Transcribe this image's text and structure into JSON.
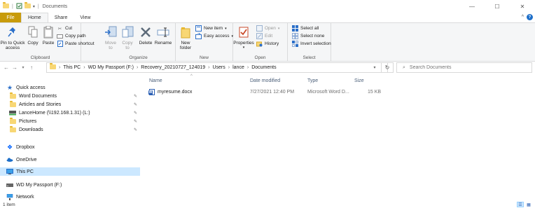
{
  "window": {
    "title": "Documents",
    "minimize": "—",
    "maximize": "☐",
    "close": "✕"
  },
  "ribbon_tabs": [
    "File",
    "Home",
    "Share",
    "View"
  ],
  "ribbon": {
    "clipboard": {
      "label": "Clipboard",
      "pin_to_quick_access": "Pin to Quick access",
      "copy": "Copy",
      "paste": "Paste",
      "cut": "Cut",
      "copy_path": "Copy path",
      "paste_shortcut": "Paste shortcut"
    },
    "organize": {
      "label": "Organize",
      "move_to": "Move to",
      "copy_to": "Copy to",
      "delete": "Delete",
      "rename": "Rename"
    },
    "new": {
      "label": "New",
      "new_folder": "New folder",
      "new_item": "New item",
      "easy_access": "Easy access"
    },
    "open": {
      "label": "Open",
      "properties": "Properties",
      "open": "Open",
      "edit": "Edit",
      "history": "History"
    },
    "select": {
      "label": "Select",
      "select_all": "Select all",
      "select_none": "Select none",
      "invert_selection": "Invert selection"
    }
  },
  "address": {
    "breadcrumbs": [
      "This PC",
      "WD My Passport (F:)",
      "Recovery_20210727_124019",
      "Users",
      "lance",
      "Documents"
    ],
    "search_placeholder": "Search Documents"
  },
  "nav": {
    "quick_access": "Quick access",
    "pinned": [
      "Word Documents",
      "Articles and Stories",
      "LanceHome (\\\\192.168.1.31) (L:)",
      "Pictures",
      "Downloads"
    ],
    "dropbox": "Dropbox",
    "onedrive": "OneDrive",
    "this_pc": "This PC",
    "wd_passport": "WD My Passport (F:)",
    "network": "Network"
  },
  "columns": {
    "name": "Name",
    "date_modified": "Date modified",
    "type": "Type",
    "size": "Size"
  },
  "files": [
    {
      "name": "myresume.docx",
      "date_modified": "7/27/2021 12:40 PM",
      "type": "Microsoft Word D...",
      "size": "15 KB"
    }
  ],
  "status": {
    "item_count": "1 item"
  },
  "colors": {
    "file_tab": "#c89b0b",
    "selection": "#cce8ff",
    "accent_blue": "#1e6fc9"
  }
}
